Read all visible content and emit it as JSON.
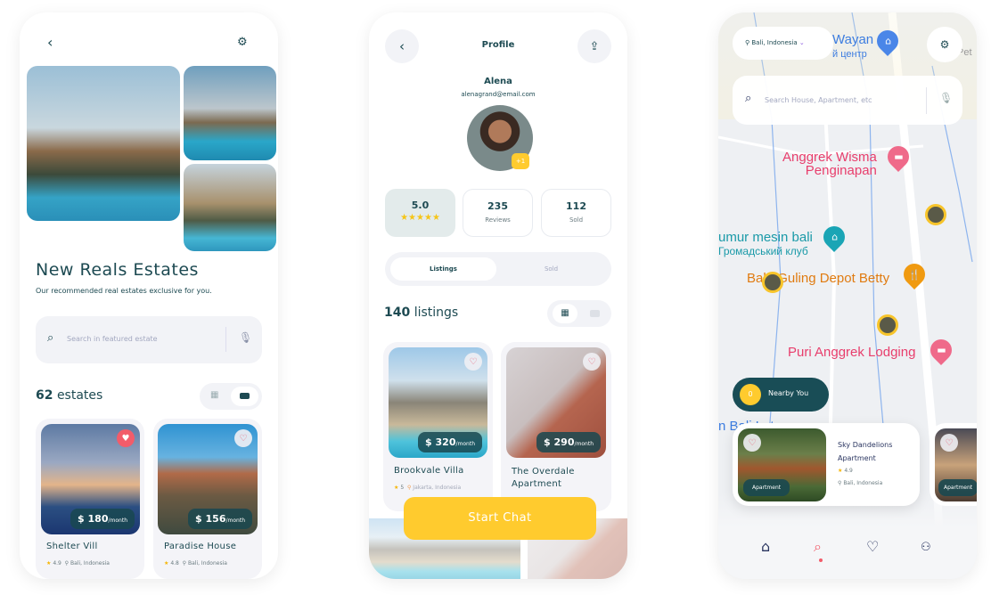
{
  "screen1": {
    "title": "New Reals Estates",
    "subtitle": "Our recommended real estates exclusive for you.",
    "search_placeholder": "Search in featured estate",
    "count_number": "62",
    "count_label": "estates",
    "view_mode": "list",
    "cards": [
      {
        "name": "Shelter Vill",
        "price": "$ 180",
        "unit": "/month",
        "rating": "4.9",
        "location": "Bali, Indonesia",
        "favorited": true
      },
      {
        "name": "Paradise House",
        "price": "$ 156",
        "unit": "/month",
        "rating": "4.8",
        "location": "Bali, Indonesia",
        "favorited": false
      }
    ]
  },
  "screen2": {
    "title": "Profile",
    "name": "Alena",
    "email": "alenagrand@email.com",
    "avatar_badge": "+1",
    "stats": {
      "rating": "5.0",
      "stars": "★★★★★",
      "reviews": "235",
      "reviews_label": "Reviews",
      "sold": "112",
      "sold_label": "Sold"
    },
    "tabs": [
      "Listings",
      "Sold"
    ],
    "active_tab": "Listings",
    "count_number": "140",
    "count_label": "listings",
    "view_mode": "grid",
    "cards": [
      {
        "name": "Brookvale Villa",
        "price": "$ 320",
        "unit": "/month",
        "rating": "5",
        "location": "Jakarta, Indonesia"
      },
      {
        "name": "The Overdale Apartment",
        "price": "$ 290",
        "unit": "/month"
      }
    ],
    "cta": "Start Chat"
  },
  "screen3": {
    "location": "Bali, Indonesia",
    "search_placeholder": "Search House, Apartment, etc",
    "map_labels": {
      "wayan": "Wayan",
      "wayan_sub": "й центр",
      "pet": "Pet",
      "anggrek1": "Anggrek Wisma",
      "anggrek2": "Penginapan",
      "sumur1": "umur mesin bali",
      "sumur2": "Громадський клуб",
      "babi": "Babi Guling Depot Betty",
      "puri": "Puri Anggrek Lodging",
      "bali": "n Bali Lotus"
    },
    "nearby_count": "0",
    "nearby_label": "Nearby You",
    "card": {
      "name": "Sky Dandelions Apartment",
      "rating": "4.9",
      "location": "Bali, Indonesia",
      "tag": "Apartment"
    },
    "card2_tag": "Apartment",
    "active_nav": "search",
    "colors": {
      "primary": "#1b4d57",
      "accent": "#ffcb2e",
      "favorite": "#f25c6a"
    }
  }
}
